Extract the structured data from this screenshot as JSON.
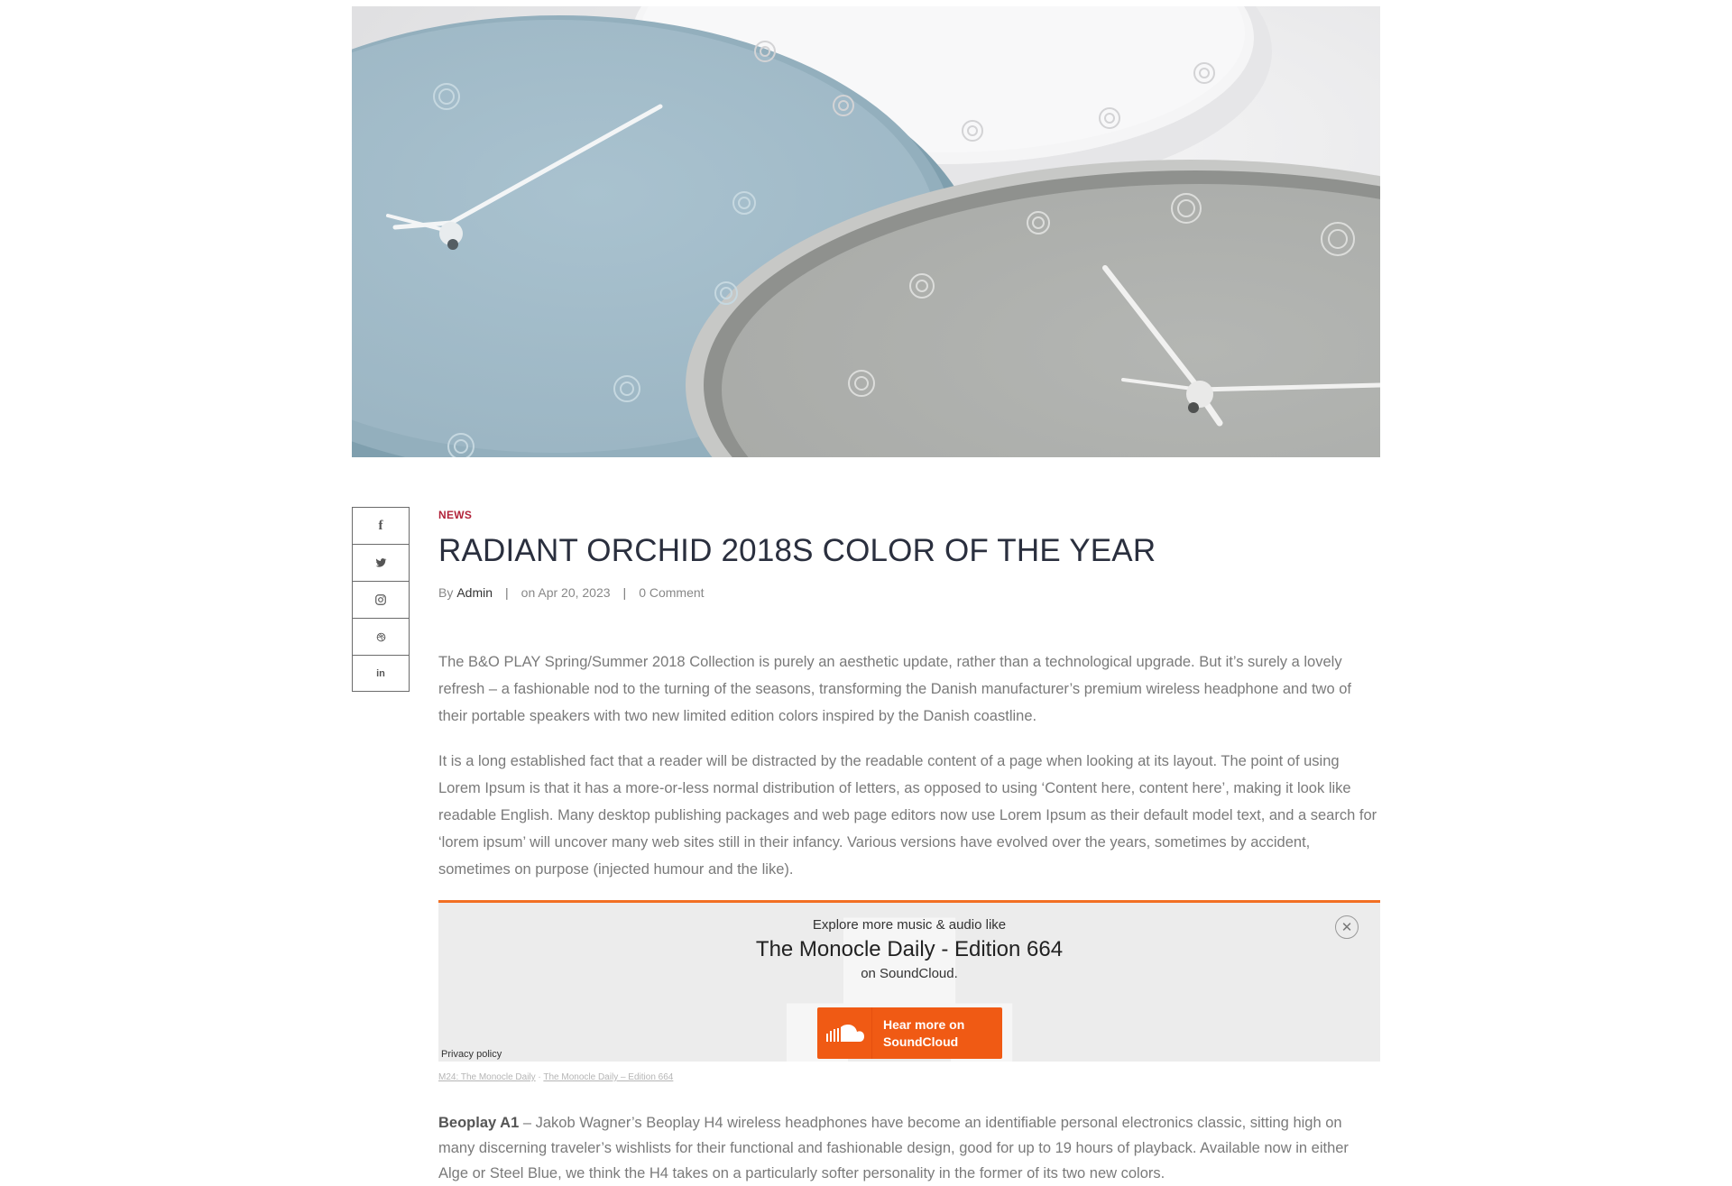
{
  "share": {
    "items": [
      "facebook-icon",
      "twitter-icon",
      "instagram-icon",
      "dribbble-icon",
      "linkedin-icon"
    ],
    "glyphs": {
      "facebook": "f",
      "linkedin": "in"
    }
  },
  "article": {
    "category": "NEWS",
    "title": "RADIANT ORCHID 2018S COLOR OF THE YEAR",
    "meta": {
      "by_label": "By",
      "author": "Admin",
      "separator": "|",
      "date": "on Apr 20, 2023",
      "comments": "0 Comment"
    },
    "paragraph_1": "The B&O PLAY Spring/Summer 2018 Collection is purely an aesthetic update, rather than a technological upgrade. But it’s surely a lovely refresh – a fashionable nod to the turning of the seasons, transforming the Danish manufacturer’s premium wireless headphone and two of their portable speakers with two new limited edition colors inspired by the Danish coastline.",
    "paragraph_2": "It is a long established fact that a reader will be distracted by the readable content of a page when looking at its layout. The point of using Lorem Ipsum is that it has a more-or-less normal distribution of letters, as opposed to using ‘Content here, content here’, making it look like readable English. Many desktop publishing packages and web page editors now use Lorem Ipsum as their default model text, and a search for ‘lorem ipsum’ will uncover many web sites still in their infancy. Various versions have evolved over the years, sometimes by accident, sometimes on purpose (injected humour and the like).",
    "paragraph_3_bold": "Beoplay A1",
    "paragraph_3": " – Jakob Wagner’s Beoplay H4 wireless headphones have become an identifiable personal electronics classic, sitting high on many discerning traveler’s wishlists for their functional and fashionable design, good for up to 19 hours of playback. Available now in either Alge or Steel Blue, we think the H4 takes on a particularly softer personality in the former of its two new colors."
  },
  "embed": {
    "explore": "Explore more music & audio like",
    "title": "The Monocle Daily - Edition 664",
    "on_soundcloud": "on SoundCloud.",
    "button_label": "Hear more on SoundCloud",
    "close_symbol": "✕",
    "privacy": "Privacy policy",
    "credit_artist": "M24: The Monocle Daily",
    "credit_separator": " · ",
    "credit_track": "The Monocle Daily – Edition 664",
    "accent": "#f26f23"
  },
  "colors": {
    "category": "#b2233a",
    "title": "#2a2f3e",
    "soundcloud": "#f05a14"
  }
}
